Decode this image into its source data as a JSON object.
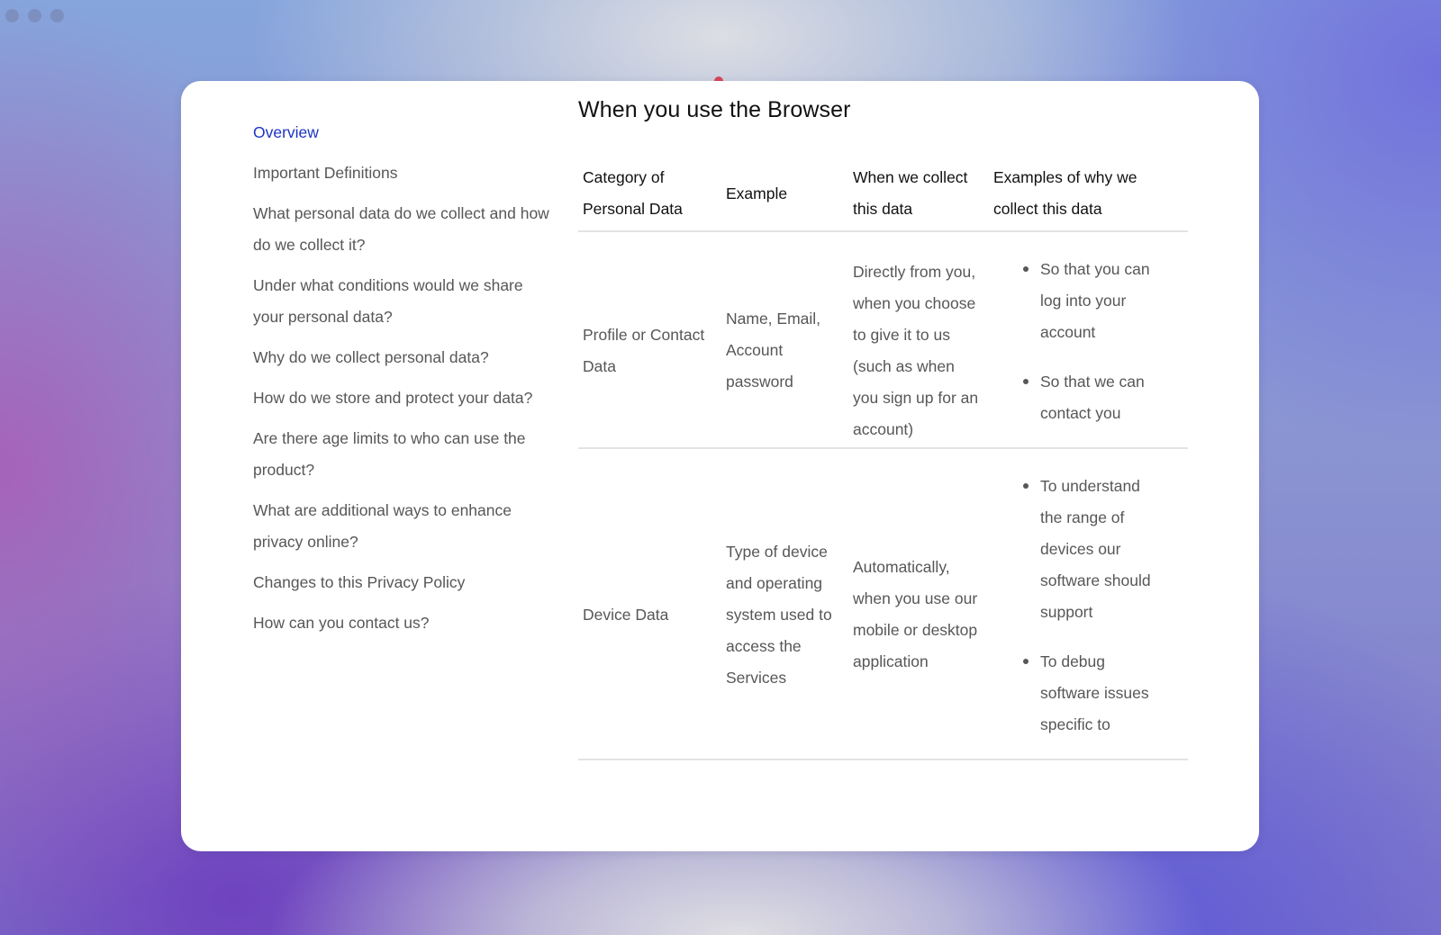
{
  "window_controls": [
    "close",
    "minimize",
    "maximize"
  ],
  "sidebar": {
    "items": [
      {
        "label": "Overview",
        "active": true
      },
      {
        "label": "Important Definitions",
        "active": false
      },
      {
        "label": "What personal data do we collect and how do we collect it?",
        "active": false
      },
      {
        "label": "Under what conditions would we share your personal data?",
        "active": false
      },
      {
        "label": "Why do we collect personal data?",
        "active": false
      },
      {
        "label": "How do we store and protect your data?",
        "active": false
      },
      {
        "label": "Are there age limits to who can use the product?",
        "active": false
      },
      {
        "label": "What are additional ways to enhance privacy online?",
        "active": false
      },
      {
        "label": "Changes to this Privacy Policy",
        "active": false
      },
      {
        "label": "How can you contact us?",
        "active": false
      }
    ],
    "active_color": "#1b33c3"
  },
  "main": {
    "title": "When you use the Browser",
    "table": {
      "headers": [
        "Category of Personal Data",
        "Example",
        "When we collect this data",
        "Examples of why we collect this data"
      ],
      "rows": [
        {
          "category": "Profile or Contact Data",
          "example": "Name, Email, Account password",
          "when": "Directly from you, when you choose to give it to us (such as when you sign up for an account)",
          "why": [
            "So that you can log into your account",
            "So that we can contact you"
          ]
        },
        {
          "category": "Device Data",
          "example": "Type of device and operating system used to access the Services",
          "when": "Automatically, when you use our mobile or desktop application",
          "why": [
            "To understand the range of devices our software should support",
            "To debug software issues specific to"
          ]
        }
      ]
    }
  }
}
